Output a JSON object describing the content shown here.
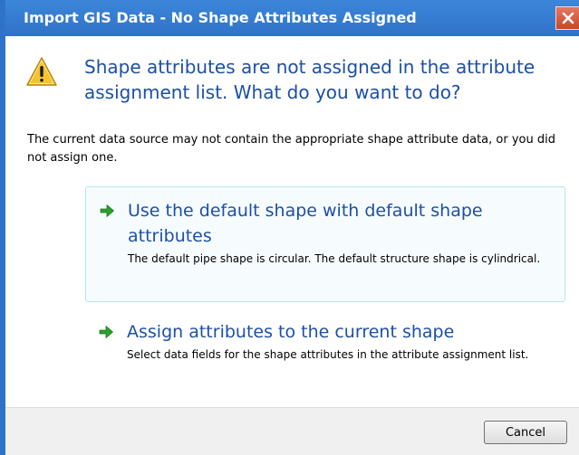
{
  "window": {
    "title": "Import GIS Data - No Shape Attributes Assigned",
    "close_icon": "close-icon"
  },
  "main": {
    "icon": "warning-icon",
    "heading": "Shape attributes are not assigned in the attribute assignment list. What do you want to do?",
    "description": "The current data source may not contain the appropriate shape attribute data, or you did not assign one."
  },
  "options": [
    {
      "icon": "green-arrow-icon",
      "title": "Use the default shape with default shape attributes",
      "description": "The default pipe shape is circular. The default structure shape is cylindrical.",
      "selected": true
    },
    {
      "icon": "green-arrow-icon",
      "title": "Assign attributes to the current shape",
      "description": "Select data fields for the shape attributes in the attribute assignment list.",
      "selected": false
    }
  ],
  "footer": {
    "cancel_label": "Cancel"
  },
  "colors": {
    "titlebar": "#2f73c9",
    "close_button": "#c7452a",
    "heading_text": "#1c4fa8",
    "selected_border": "#b9e3ef",
    "arrow": "#2e9e2e"
  }
}
